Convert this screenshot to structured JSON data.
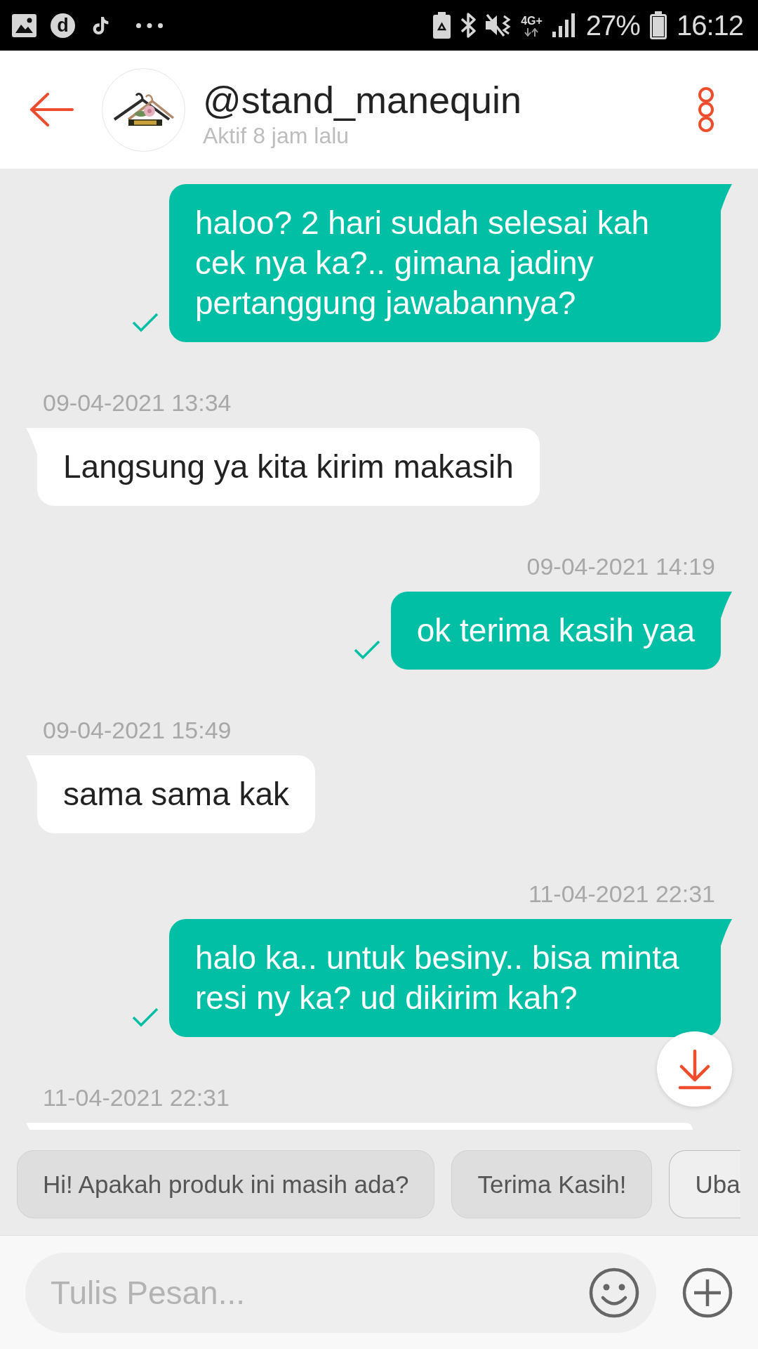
{
  "status_bar": {
    "app_letter": "d",
    "network": "4G+",
    "battery": "27%",
    "time": "16:12"
  },
  "header": {
    "title": "@stand_manequin",
    "subtitle": "Aktif 8 jam lalu"
  },
  "messages": [
    {
      "kind": "outgoing",
      "text": "haloo? 2 hari sudah selesai kah cek nya ka?.. gimana jadiny pertanggung jawabannya?",
      "sent": true
    },
    {
      "kind": "incoming",
      "time": "09-04-2021 13:34",
      "text": "Langsung ya kita kirim makasih",
      "sent": false
    },
    {
      "kind": "outgoing",
      "time": "09-04-2021 14:19",
      "text": "ok terima kasih yaa",
      "sent": true
    },
    {
      "kind": "incoming",
      "time": "09-04-2021 15:49",
      "text": "sama sama kak",
      "sent": false
    },
    {
      "kind": "outgoing",
      "time": "11-04-2021 22:31",
      "text": "halo ka.. untuk besiny.. bisa minta resi ny ka? ud dikirim kah?",
      "sent": true
    },
    {
      "kind": "incoming",
      "time": "11-04-2021 22:31",
      "sent": false
    }
  ],
  "quick_replies": [
    {
      "label": "Hi! Apakah produk ini masih ada?",
      "kind": "filled"
    },
    {
      "label": "Terima Kasih!",
      "kind": "filled"
    },
    {
      "label": "Uba",
      "kind": "outlined"
    }
  ],
  "composer": {
    "placeholder": "Tulis Pesan..."
  }
}
